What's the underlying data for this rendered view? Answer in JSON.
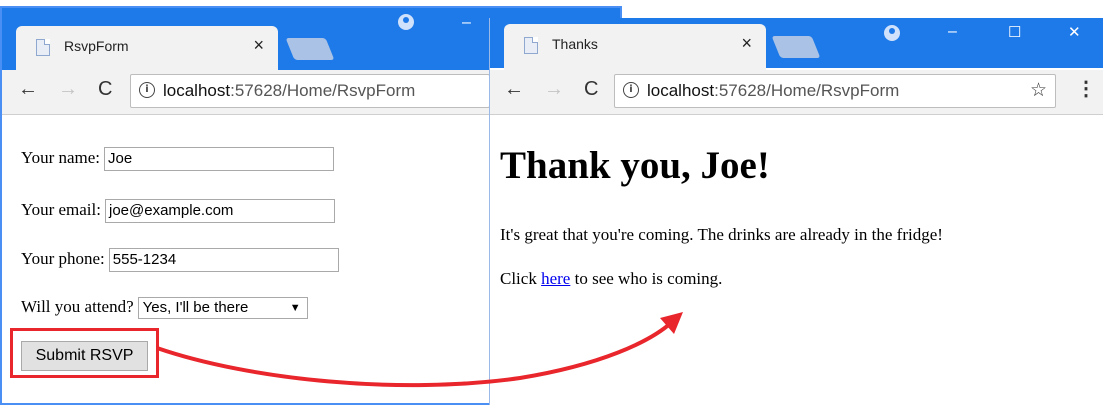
{
  "form_window": {
    "tab_title": "RsvpForm",
    "tab_close": "×",
    "url_host": "localhost",
    "url_path": ":57628/Home/RsvpForm",
    "minimize": "–",
    "name_label": "Your name:",
    "name_value": "Joe",
    "email_label": "Your email:",
    "email_value": "joe@example.com",
    "phone_label": "Your phone:",
    "phone_value": "555-1234",
    "attend_label": "Will you attend?",
    "attend_value": "Yes, I'll be there",
    "submit_label": "Submit RSVP"
  },
  "thanks_window": {
    "tab_title": "Thanks",
    "tab_close": "×",
    "url_host": "localhost",
    "url_path": ":57628/Home/RsvpForm",
    "minimize": "–",
    "maximize": "☐",
    "close": "✕",
    "heading": "Thank you, Joe!",
    "message": "It's great that you're coming. The drinks are already in the fridge!",
    "click_prefix": "Click",
    "link_text": "here",
    "click_suffix": "to see who is coming."
  },
  "colors": {
    "chrome_blue": "#1e7ae8",
    "highlight_red": "#e8262c"
  }
}
